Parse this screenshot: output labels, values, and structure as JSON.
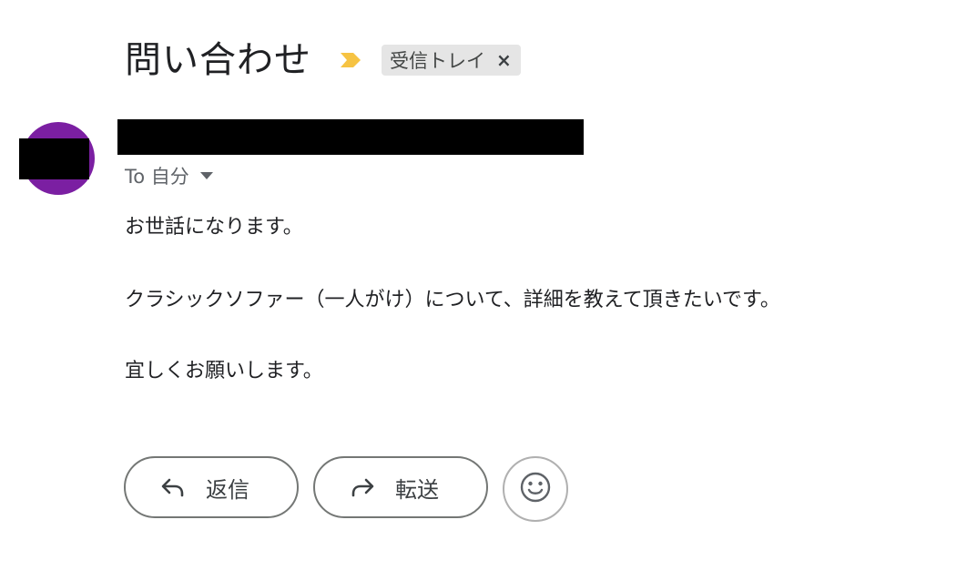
{
  "email": {
    "subject": "問い合わせ",
    "label": "受信トレイ",
    "label_remove": "×",
    "recipient": "To 自分",
    "body_lines": [
      "お世話になります。",
      "クラシックソファー（一人がけ）について、詳細を教えて頂きたいです。",
      "宜しくお願いします。"
    ]
  },
  "actions": {
    "reply_label": "返信",
    "forward_label": "転送"
  },
  "icons": {
    "importance": "importance-marker-icon",
    "reply": "reply-arrow-icon",
    "forward": "forward-arrow-icon",
    "emoji": "smiley-face-icon",
    "recipient_details": "caret-down-icon"
  },
  "colors": {
    "avatar": "#7b1fa2",
    "importance_marker": "#f6c343",
    "label_chip_bg": "#e5e5e5",
    "redaction": "#000000"
  }
}
